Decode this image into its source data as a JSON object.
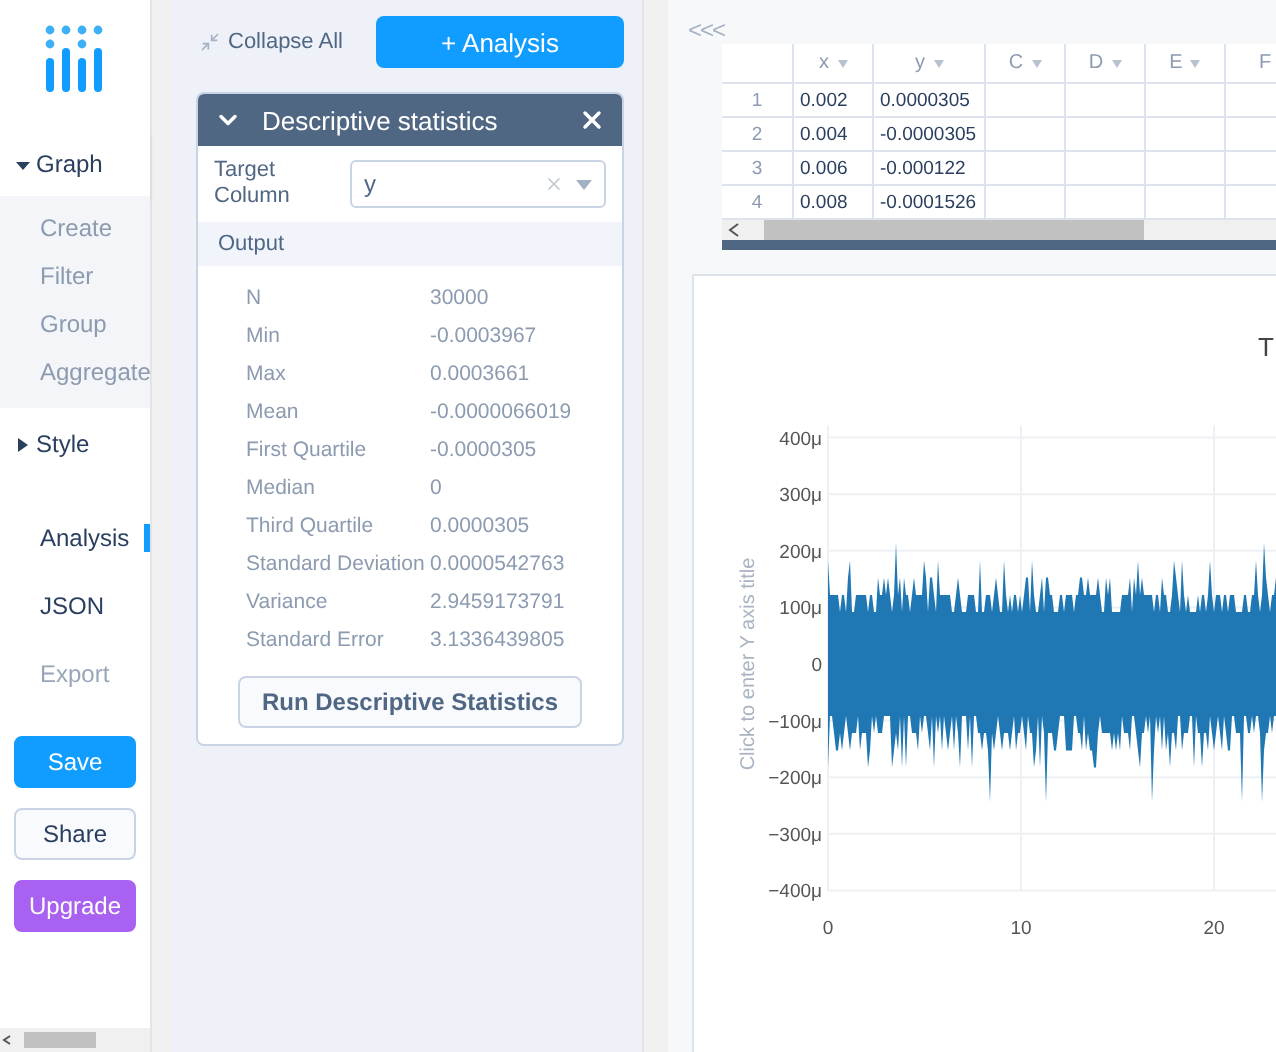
{
  "nav": [
    {
      "label": "Graph",
      "kind": "section",
      "expanded": true,
      "children": [
        {
          "label": "Create"
        },
        {
          "label": "Filter"
        },
        {
          "label": "Group"
        },
        {
          "label": "Aggregate"
        }
      ]
    },
    {
      "label": "Style",
      "kind": "section",
      "expanded": false
    },
    {
      "label": "Analysis",
      "kind": "link",
      "selected": true,
      "disabled": false
    },
    {
      "label": "JSON",
      "kind": "link",
      "selected": false,
      "disabled": false
    },
    {
      "label": "Export",
      "kind": "link",
      "selected": false,
      "disabled": true
    }
  ],
  "actions": [
    {
      "label": "Save",
      "kind": "primary"
    },
    {
      "label": "Share",
      "kind": "secondary"
    },
    {
      "label": "Upgrade",
      "kind": "premium"
    }
  ],
  "toolbar": {
    "collapse": "Collapse All",
    "add": "+ Analysis"
  },
  "analysis": {
    "title": "Descriptive statistics",
    "expanded": true,
    "target_label": "Target Column",
    "target_value": "y",
    "output_label": "Output",
    "stats": [
      {
        "label": "N",
        "value": "30000"
      },
      {
        "label": "Min",
        "value": "-0.0003967"
      },
      {
        "label": "Max",
        "value": "0.0003661"
      },
      {
        "label": "Mean",
        "value": "-0.0000066019"
      },
      {
        "label": "First Quartile",
        "value": "-0.0000305"
      },
      {
        "label": "Median",
        "value": "0"
      },
      {
        "label": "Third Quartile",
        "value": "0.0000305"
      },
      {
        "label": "Standard Deviation",
        "value": "0.0000542763"
      },
      {
        "label": "Variance",
        "value": "2.9459173791"
      },
      {
        "label": "Standard Error",
        "value": "3.1336439805"
      }
    ],
    "run": "Run Descriptive Statistics"
  },
  "grid": {
    "collapse": "<<<",
    "columns": [
      "",
      "x",
      "y",
      "C",
      "D",
      "E",
      "F"
    ],
    "rows": [
      [
        "1",
        "0.002",
        "0.0000305"
      ],
      [
        "2",
        "0.004",
        "-0.0000305"
      ],
      [
        "3",
        "0.006",
        "-0.000122"
      ],
      [
        "4",
        "0.008",
        "-0.0001526"
      ]
    ]
  },
  "plot": {
    "title": "T",
    "y_axis_title": "Click to enter Y axis title",
    "y_ticks": [
      "400μ",
      "300μ",
      "200μ",
      "100μ",
      "0",
      "−100μ",
      "−200μ",
      "−300μ",
      "−400μ"
    ],
    "x_ticks": [
      "0",
      "10",
      "20"
    ]
  }
}
